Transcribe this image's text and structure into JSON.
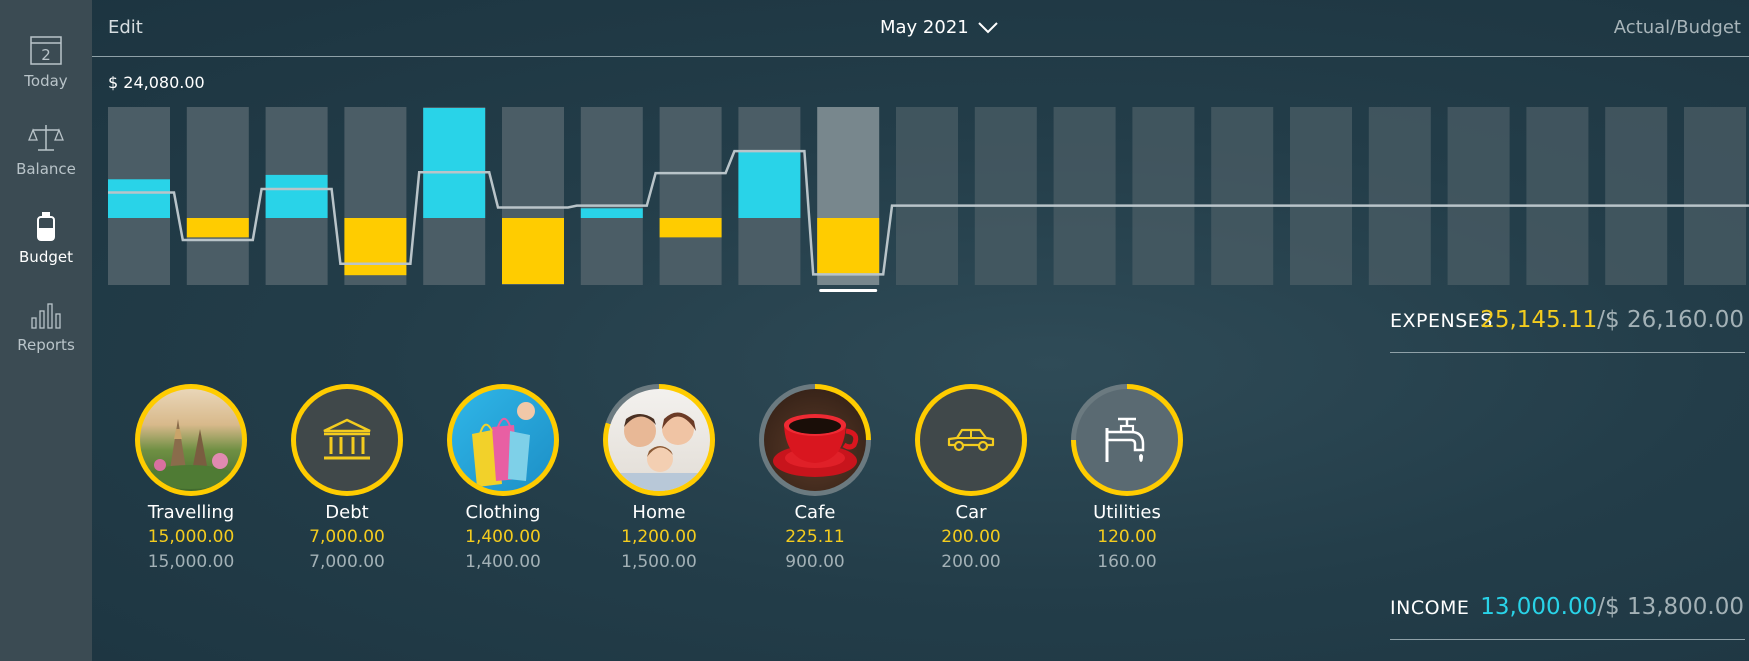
{
  "sidebar": {
    "items": [
      {
        "label": "Today",
        "icon": "calendar-icon",
        "day": "2",
        "active": false
      },
      {
        "label": "Balance",
        "icon": "scales-icon",
        "active": false
      },
      {
        "label": "Budget",
        "icon": "budget-jar-icon",
        "active": true
      },
      {
        "label": "Reports",
        "icon": "bar-chart-icon",
        "active": false
      }
    ]
  },
  "header": {
    "edit_label": "Edit",
    "month_label": "May 2021",
    "mode_label": "Actual/Budget"
  },
  "colors": {
    "income": "#29d3e8",
    "expense": "#ffcc00",
    "sidebar": "#3b4b53",
    "bar_bg": "#4b5d66",
    "bar_selected": "#78878d"
  },
  "chart_data": {
    "type": "bar",
    "max_label": "$ 24,080.00",
    "selected_index": 9,
    "months": 21,
    "net_fraction": [
      0.44,
      -0.22,
      0.49,
      -0.65,
      1.25,
      -0.75,
      0.11,
      -0.22,
      0.76,
      -0.64,
      null,
      null,
      null,
      null,
      null,
      null,
      null,
      null,
      null,
      null,
      null
    ],
    "line_fraction": [
      0.29,
      -0.25,
      0.33,
      -0.52,
      0.52,
      0.12,
      0.14,
      0.51,
      0.76,
      -0.64,
      0.14,
      0.14,
      0.14,
      0.14,
      0.14,
      0.14,
      0.14,
      0.14,
      0.14,
      0.14,
      0.14
    ]
  },
  "summary": {
    "expenses": {
      "label": "EXPENSES",
      "actual": "25,145.11",
      "budget": "/$ 26,160.00"
    },
    "income": {
      "label": "INCOME",
      "actual": "13,000.00",
      "budget": "/$ 13,800.00"
    }
  },
  "categories": [
    {
      "name": "Travelling",
      "actual": "15,000.00",
      "budget": "15,000.00",
      "progress": 1.0,
      "icon": "travel-photo-icon"
    },
    {
      "name": "Debt",
      "actual": "7,000.00",
      "budget": "7,000.00",
      "progress": 1.0,
      "icon": "bank-icon"
    },
    {
      "name": "Clothing",
      "actual": "1,400.00",
      "budget": "1,400.00",
      "progress": 1.0,
      "icon": "shopping-bags-icon"
    },
    {
      "name": "Home",
      "actual": "1,200.00",
      "budget": "1,500.00",
      "progress": 0.8,
      "icon": "family-photo-icon"
    },
    {
      "name": "Cafe",
      "actual": "225.11",
      "budget": "900.00",
      "progress": 0.25,
      "icon": "coffee-cup-icon"
    },
    {
      "name": "Car",
      "actual": "200.00",
      "budget": "200.00",
      "progress": 1.0,
      "icon": "car-icon"
    },
    {
      "name": "Utilities",
      "actual": "120.00",
      "budget": "160.00",
      "progress": 0.75,
      "icon": "water-tap-icon"
    }
  ]
}
